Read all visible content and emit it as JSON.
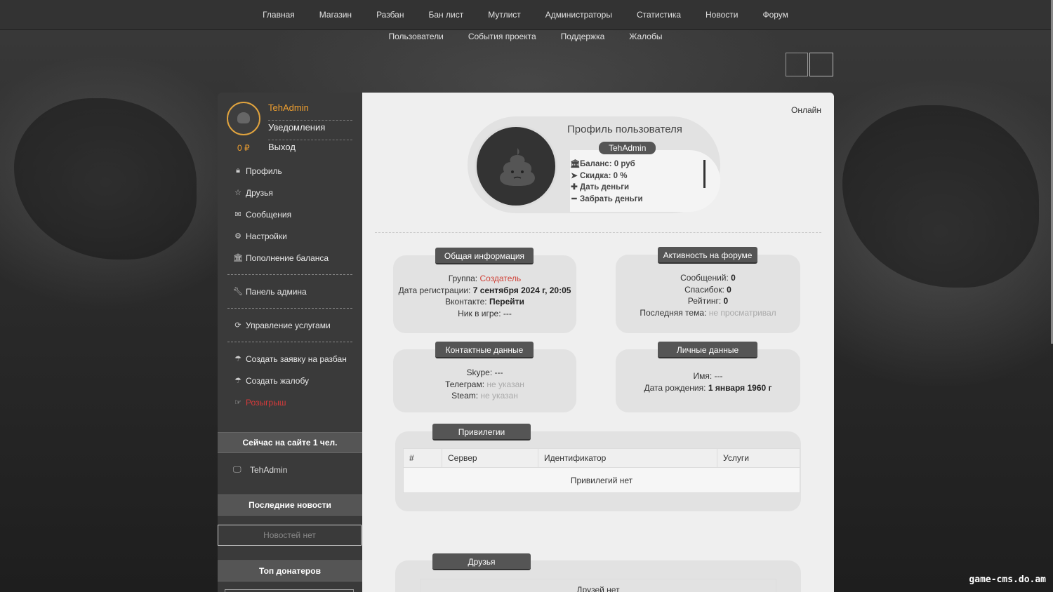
{
  "nav": {
    "row1": [
      "Главная",
      "Магазин",
      "Разбан",
      "Бан лист",
      "Мутлист",
      "Администраторы",
      "Статистика",
      "Новости",
      "Форум"
    ],
    "row2": [
      "Пользователи",
      "События проекта",
      "Поддержка",
      "Жалобы"
    ]
  },
  "user": {
    "name": "TehAdmin",
    "notifications": "Уведомления",
    "logout": "Выход",
    "balance": "0 ₽"
  },
  "menu": {
    "profile": "Профиль",
    "friends": "Друзья",
    "messages": "Сообщения",
    "settings": "Настройки",
    "topup": "Пополнение баланса",
    "admin_panel": "Панель админа",
    "services": "Управление услугами",
    "unban_request": "Создать заявку на разбан",
    "complaint": "Создать жалобу",
    "raffle": "Розыгрыш"
  },
  "sidebar": {
    "online_header": "Сейчас на сайте 1 чел.",
    "online_user": "TehAdmin",
    "news_header": "Последние новости",
    "news_empty": "Новостей нет",
    "donors_header": "Топ донатеров"
  },
  "main": {
    "online_label": "Онлайн",
    "profile_title": "Профиль пользователя",
    "profile_name": "TehAdmin",
    "balance": "Баланс: 0 руб",
    "discount": "Скидка: 0 %",
    "give_money": "Дать деньги",
    "take_money": "Забрать деньги"
  },
  "general": {
    "title": "Общая информация",
    "group_label": "Группа:",
    "group_value": "Создатель",
    "reg_label": "Дата регистрации:",
    "reg_value": "7 сентября 2024 г, 20:05",
    "vk_label": "Вконтакте:",
    "vk_value": "Перейти",
    "nick_label": "Ник в игре:",
    "nick_value": "---"
  },
  "forum": {
    "title": "Активность на форуме",
    "messages_label": "Сообщений:",
    "messages_value": "0",
    "thanks_label": "Спасибок:",
    "thanks_value": "0",
    "rating_label": "Рейтинг:",
    "rating_value": "0",
    "last_topic_label": "Последняя тема:",
    "last_topic_value": "не просматривал"
  },
  "contacts": {
    "title": "Контактные данные",
    "skype_label": "Skype:",
    "skype_value": "---",
    "telegram_label": "Телеграм:",
    "telegram_value": "не указан",
    "steam_label": "Steam:",
    "steam_value": "не указан"
  },
  "personal": {
    "title": "Личные данные",
    "name_label": "Имя:",
    "name_value": "---",
    "birth_label": "Дата рождения:",
    "birth_value": "1 января 1960 г"
  },
  "privileges": {
    "title": "Привилегии",
    "columns": [
      "#",
      "Сервер",
      "Идентификатор",
      "Услуги"
    ],
    "empty": "Привилегий нет"
  },
  "friends": {
    "title": "Друзья",
    "empty": "Друзей нет"
  },
  "watermark": "game-cms.do.am",
  "colors": {
    "accent": "#f0a030",
    "red": "#d0443a",
    "sidebar": "#3a3a3a",
    "nav": "#333333"
  }
}
